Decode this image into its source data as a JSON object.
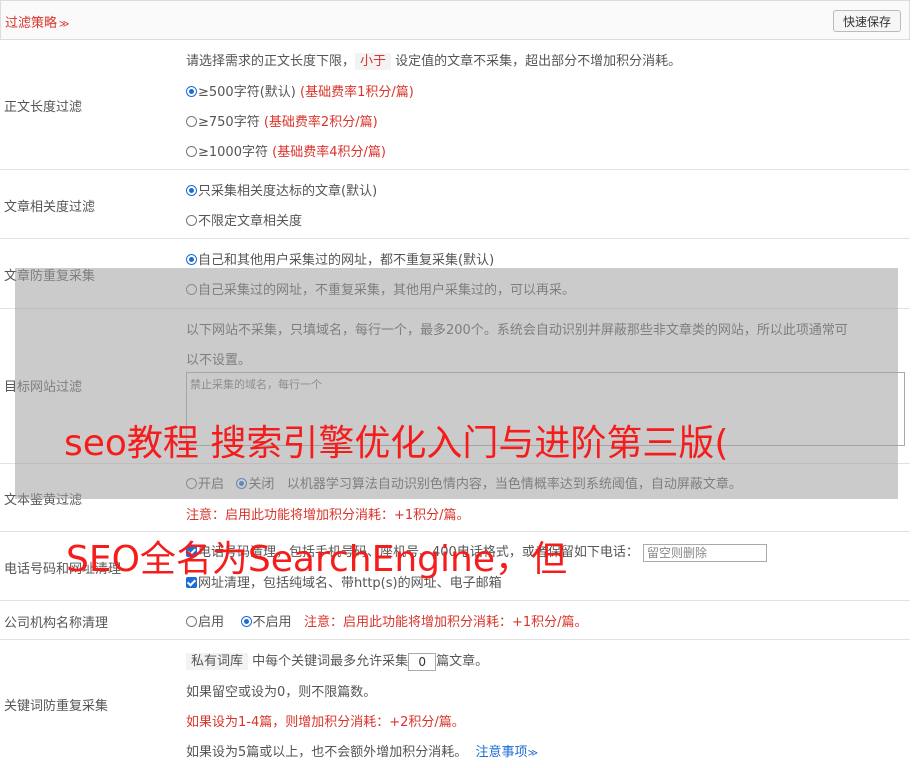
{
  "header": {
    "title": "过滤策略",
    "chevron": "≫",
    "save_label": "快速保存"
  },
  "content_length": {
    "label": "正文长度过滤",
    "desc_pre": "请选择需求的正文长度下限，",
    "desc_tag": "小于",
    "desc_post": "设定值的文章不采集，超出部分不增加积分消耗。",
    "options": [
      {
        "text": "≥500字符(默认)",
        "rate": "(基础费率1积分/篇)"
      },
      {
        "text": "≥750字符",
        "rate": "(基础费率2积分/篇)"
      },
      {
        "text": "≥1000字符",
        "rate": "(基础费率4积分/篇)"
      }
    ]
  },
  "relevance": {
    "label": "文章相关度过滤",
    "options": [
      "只采集相关度达标的文章(默认)",
      "不限定文章相关度"
    ]
  },
  "dedup": {
    "label": "文章防重复采集",
    "options": [
      "自己和其他用户采集过的网址，都不重复采集(默认)",
      "自己采集过的网址，不重复采集，其他用户采集过的，可以再采。"
    ]
  },
  "target_site": {
    "label": "目标网站过滤",
    "desc1": "以下网站不采集，只填域名，每行一个，最多200个。系统会自动识别并屏蔽那些非文章类的网站，所以此项通常可",
    "desc2": "以不设置。",
    "placeholder": "禁止采集的域名，每行一个"
  },
  "porn_filter": {
    "label": "文本鉴黄过滤",
    "on": "开启",
    "off": "关闭",
    "desc": "以机器学习算法自动识别色情内容，当色情概率达到系统阈值，自动屏蔽文章。",
    "note": "注意：启用此功能将增加积分消耗：+1积分/篇。"
  },
  "phone_filter": {
    "label": "电话号码和网址清理",
    "line1_pre": "电话号码清理，包括手机号码、座机号、400电话格式，或者保留如下电话：",
    "input_placeholder": "留空则删除",
    "line2": "网址清理，包括纯域名、带http(s)的网址、电子邮箱"
  },
  "org_filter": {
    "label": "公司机构名称清理",
    "on": "启用",
    "off": "不启用",
    "note": "注意：启用此功能将增加积分消耗：+1积分/篇。"
  },
  "keyword_dedup": {
    "label": "关键词防重复采集",
    "tag": "私有词库",
    "line1_mid": "中每个关键词最多允许采集",
    "value": "0",
    "line1_post": "篇文章。",
    "line2": "如果留空或设为0，则不限篇数。",
    "line3": "如果设为1-4篇，则增加积分消耗：+2积分/篇。",
    "line4": "如果设为5篇或以上，也不会额外增加积分消耗。",
    "link": "注意事项",
    "link_chev": "≫"
  },
  "watermark": {
    "line1": "seo教程 搜索引擎优化入门与进阶第三版(",
    "line2": "SEO全名为SearchEngine，但"
  }
}
